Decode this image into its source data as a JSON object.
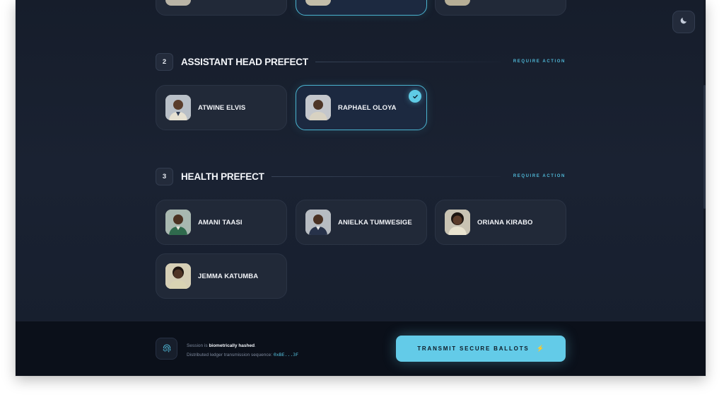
{
  "theme_toggle": {
    "icon": "moon-icon"
  },
  "top_row": {
    "cards": 3,
    "selected_index": 1
  },
  "sections": [
    {
      "number": "2",
      "title": "ASSISTANT HEAD PREFECT",
      "action": "REQUIRE ACTION",
      "candidates": [
        {
          "name": "ATWINE ELVIS",
          "selected": false
        },
        {
          "name": "RAPHAEL OLOYA",
          "selected": true
        }
      ]
    },
    {
      "number": "3",
      "title": "HEALTH PREFECT",
      "action": "REQUIRE ACTION",
      "candidates": [
        {
          "name": "AMANI TAASI",
          "selected": false
        },
        {
          "name": "ANIELKA TUMWESIGE",
          "selected": false
        },
        {
          "name": "ORIANA KIRABO",
          "selected": false
        },
        {
          "name": "JEMMA KATUMBA",
          "selected": false
        }
      ]
    }
  ],
  "footer": {
    "session_prefix": "Session is ",
    "session_bold": "biometrically hashed",
    "session_suffix": ".",
    "sequence_label": "Distributed ledger transmission sequence: ",
    "sequence_value": "0xBE...3F",
    "transmit_label": "TRANSMIT SECURE BALLOTS",
    "transmit_icon": "⚡"
  },
  "colors": {
    "accent": "#63cbe8",
    "background": "#1a2232",
    "card": "#212938",
    "footer": "#0b101a"
  }
}
